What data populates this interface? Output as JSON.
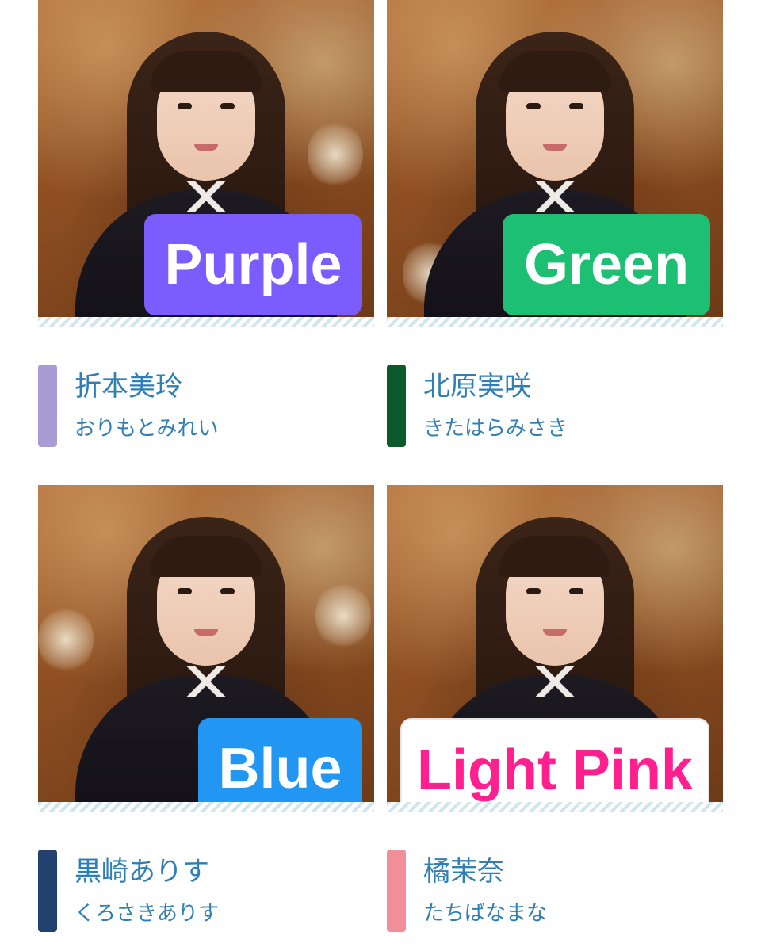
{
  "members": [
    {
      "name": "折本美玲",
      "kana": "おりもとみれい",
      "color_label": "Purple",
      "badge_bg": "#7b5cff",
      "badge_text_color": "#ffffff",
      "bar_color": "#a99bd3"
    },
    {
      "name": "北原実咲",
      "kana": "きたはらみさき",
      "color_label": "Green",
      "badge_bg": "#1dbf73",
      "badge_text_color": "#ffffff",
      "bar_color": "#0b5a2c"
    },
    {
      "name": "黒崎ありす",
      "kana": "くろさきありす",
      "color_label": "Blue",
      "badge_bg": "#2196f3",
      "badge_text_color": "#ffffff",
      "bar_color": "#22416f"
    },
    {
      "name": "橘茉奈",
      "kana": "たちばなまな",
      "color_label": "Light Pink",
      "badge_bg": "#ffffff",
      "badge_text_color": "#ff1f8e",
      "bar_color": "#f08f9a"
    }
  ]
}
